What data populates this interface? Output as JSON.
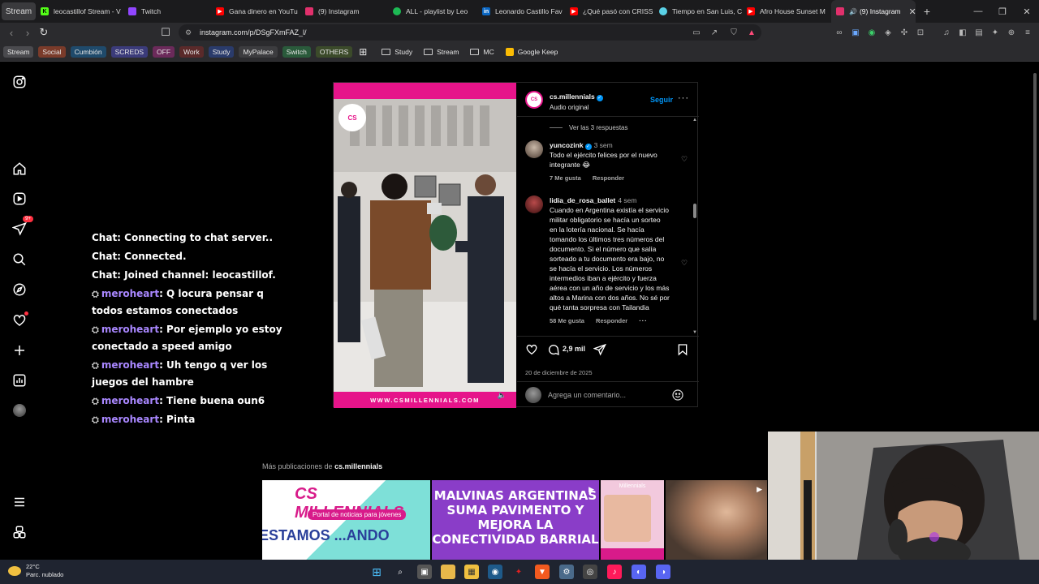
{
  "browser": {
    "tabs": [
      {
        "label": "Stream",
        "color": "#3a3a3d"
      },
      {
        "label": "leocastillof Stream - V",
        "color": "#53fc18"
      },
      {
        "label": "Twitch",
        "color": "#9146ff"
      },
      {
        "label": "Gana dinero en YouTu",
        "color": "#ff0000"
      },
      {
        "label": "(9) Instagram",
        "color": "#e1306c"
      },
      {
        "label": "ALL - playlist by Leo",
        "color": "#1db954"
      },
      {
        "label": "Leonardo Castillo Fav",
        "color": "#0a66c2"
      },
      {
        "label": "¿Qué pasó con CRISS",
        "color": "#ff0000"
      },
      {
        "label": "Tiempo en San Luis, C",
        "color": "#5ad1e6"
      },
      {
        "label": "Afro House Sunset M",
        "color": "#ff0000"
      },
      {
        "label": "(9) Instagram",
        "color": "#e1306c"
      }
    ],
    "url": "instagram.com/p/DSgFXmFAZ_l/",
    "bookmarks": {
      "chips": [
        {
          "label": "Stream",
          "color": "#4a4a4e"
        },
        {
          "label": "Social",
          "color": "#7a3b2a"
        },
        {
          "label": "Cumbión",
          "color": "#1f4a6b"
        },
        {
          "label": "SCREDS",
          "color": "#3b3b7a"
        },
        {
          "label": "OFF",
          "color": "#6b2a5a"
        },
        {
          "label": "Work",
          "color": "#5a2a2a"
        },
        {
          "label": "Study",
          "color": "#2a3b6b"
        },
        {
          "label": "MyPalace",
          "color": "#3c3c3f"
        },
        {
          "label": "Switch",
          "color": "#2a5a3b"
        },
        {
          "label": "OTHERS",
          "color": "#3b4a2a"
        }
      ],
      "folders": [
        "Study",
        "Stream",
        "MC",
        "Google Keep"
      ]
    }
  },
  "rail": {
    "notifications_badge": "9+"
  },
  "chat": {
    "system": [
      "Chat: Connecting to chat server..",
      "Chat: Connected.",
      "Chat: Joined channel: leocastillof."
    ],
    "messages": [
      {
        "user": "meroheart",
        "text": ": Q locura pensar q todos estamos conectados"
      },
      {
        "user": "meroheart",
        "text": ": Por ejemplo yo estoy conectado a speed amigo"
      },
      {
        "user": "meroheart",
        "text": ": Uh tengo q ver los juegos del hambre"
      },
      {
        "user": "meroheart",
        "text": ": Tiene buena oun6"
      },
      {
        "user": "meroheart",
        "text": ": Pinta"
      }
    ]
  },
  "post": {
    "media_footer": "WWW.CSMILLENNIALS.COM",
    "media_logo": "CS",
    "author": "cs.millennials",
    "audio": "Audio original",
    "follow_label": "Seguir",
    "more_label": "···",
    "view_replies": "Ver las 3 respuestas",
    "comments": [
      {
        "user": "yuncozink",
        "time": "3 sem",
        "text": "Todo el ejército felices por el nuevo integrante 😂",
        "likes": "7 Me gusta",
        "reply": "Responder"
      },
      {
        "user": "lidia_de_rosa_ballet",
        "time": "4 sem",
        "text": "Cuando en Argentina existía el servicio militar obligatorio se hacía un sorteo en la lotería nacional. Se hacía tomando los últimos tres números del documento. Si el número que salía sorteado a tu documento era bajo, no se hacía el servicio. Los números intermedios iban a ejército y fuerza aérea con un año de servicio y los más altos a Marina con dos años. No sé por qué tanta sorpresa con Tailandia",
        "likes": "58 Me gusta",
        "reply": "Responder"
      }
    ],
    "comment_count": "2,9 mil",
    "date": "20 de diciembre de 2025",
    "add_comment_placeholder": "Agrega un comentario..."
  },
  "more_posts": {
    "prefix": "Más publicaciones de",
    "author": "cs.millennials",
    "thumbs": [
      {
        "title": "CS MILLENNIALS",
        "subtitle": "Portal de noticias para jóvenes",
        "extra": "ESTAMOS ...ANDO"
      },
      {
        "title": "MALVINAS ARGENTINAS SUMA PAVIMENTO Y MEJORA LA CONECTIVIDAD BARRIAL"
      },
      {
        "title": "Millennials"
      },
      {
        "title": ""
      }
    ]
  },
  "taskbar": {
    "temperature": "22°C",
    "condition": "Parc. nublado"
  },
  "colors": {
    "ig_blue": "#0095f6",
    "brand_pink": "#e6148a",
    "chat_user": "#a987ff"
  }
}
